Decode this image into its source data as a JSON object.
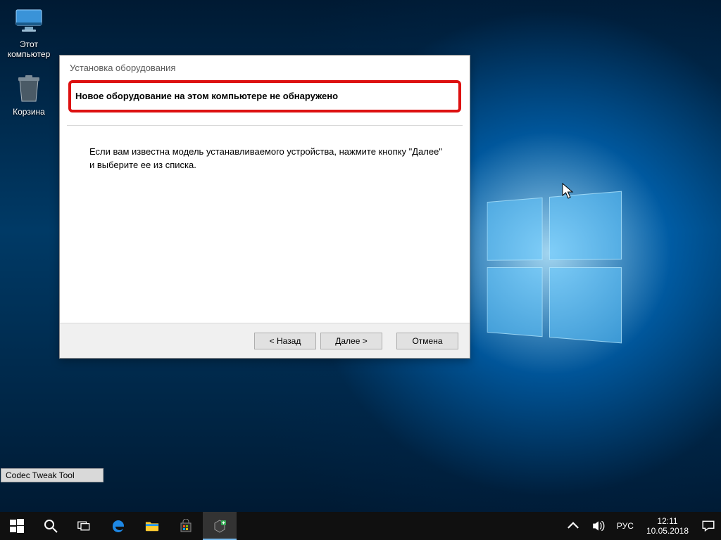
{
  "desktop": {
    "icon_pc": "Этот компьютер",
    "icon_bin": "Корзина",
    "float_label": "Codec Tweak Tool"
  },
  "wizard": {
    "title": "Установка оборудования",
    "caption": "Новое оборудование на этом компьютере не обнаружено",
    "body": "Если вам известна модель устанавливаемого устройства, нажмите кнопку \"Далее\" и выберите ее из списка.",
    "btn_back": "< Назад",
    "btn_next": "Далее >",
    "btn_cancel": "Отмена"
  },
  "taskbar": {
    "lang": "РУС",
    "time": "12:11",
    "date": "10.05.2018"
  }
}
